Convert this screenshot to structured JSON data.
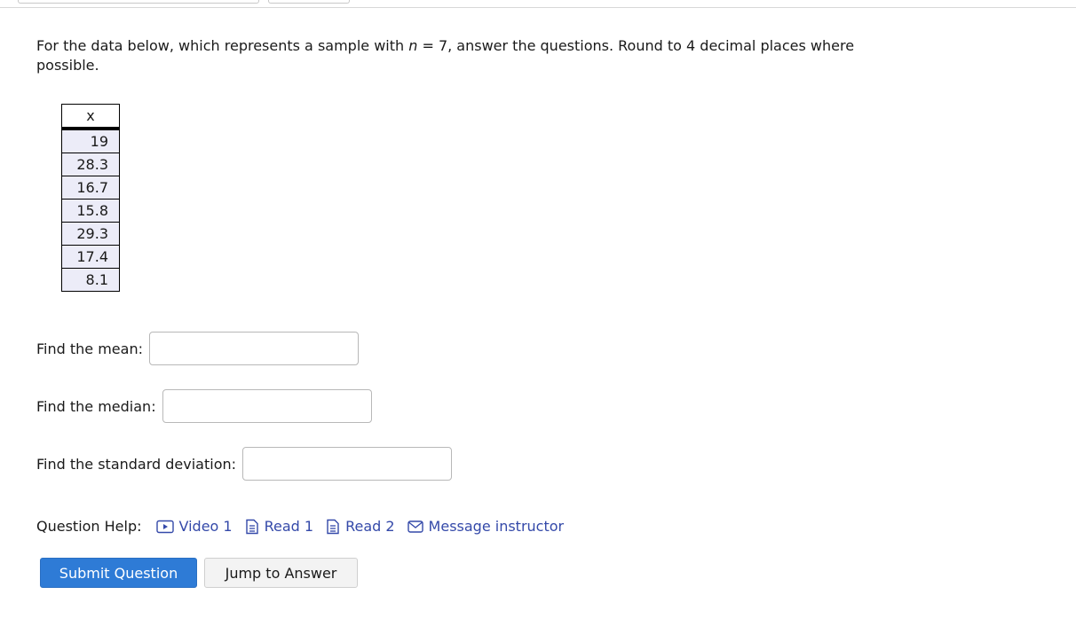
{
  "question": {
    "prompt_before": "For the data below, which represents a sample with ",
    "var_n": "n",
    "prompt_after": " = 7, answer the questions. Round to 4 decimal places where possible."
  },
  "table": {
    "header": "x",
    "values": [
      "19",
      "28.3",
      "16.7",
      "15.8",
      "29.3",
      "17.4",
      "8.1"
    ]
  },
  "fields": {
    "mean_label": "Find the mean:",
    "mean_value": "",
    "median_label": "Find the median:",
    "median_value": "",
    "sd_label": "Find the standard deviation:",
    "sd_value": ""
  },
  "help": {
    "label": "Question Help:",
    "video1": "Video 1",
    "read1": "Read 1",
    "read2": "Read 2",
    "message": "Message instructor"
  },
  "buttons": {
    "submit": "Submit Question",
    "jump": "Jump to Answer"
  },
  "colors": {
    "link": "#3449a9",
    "submit_bg": "#2e7bd6",
    "cell_bg": "#ececf8"
  }
}
